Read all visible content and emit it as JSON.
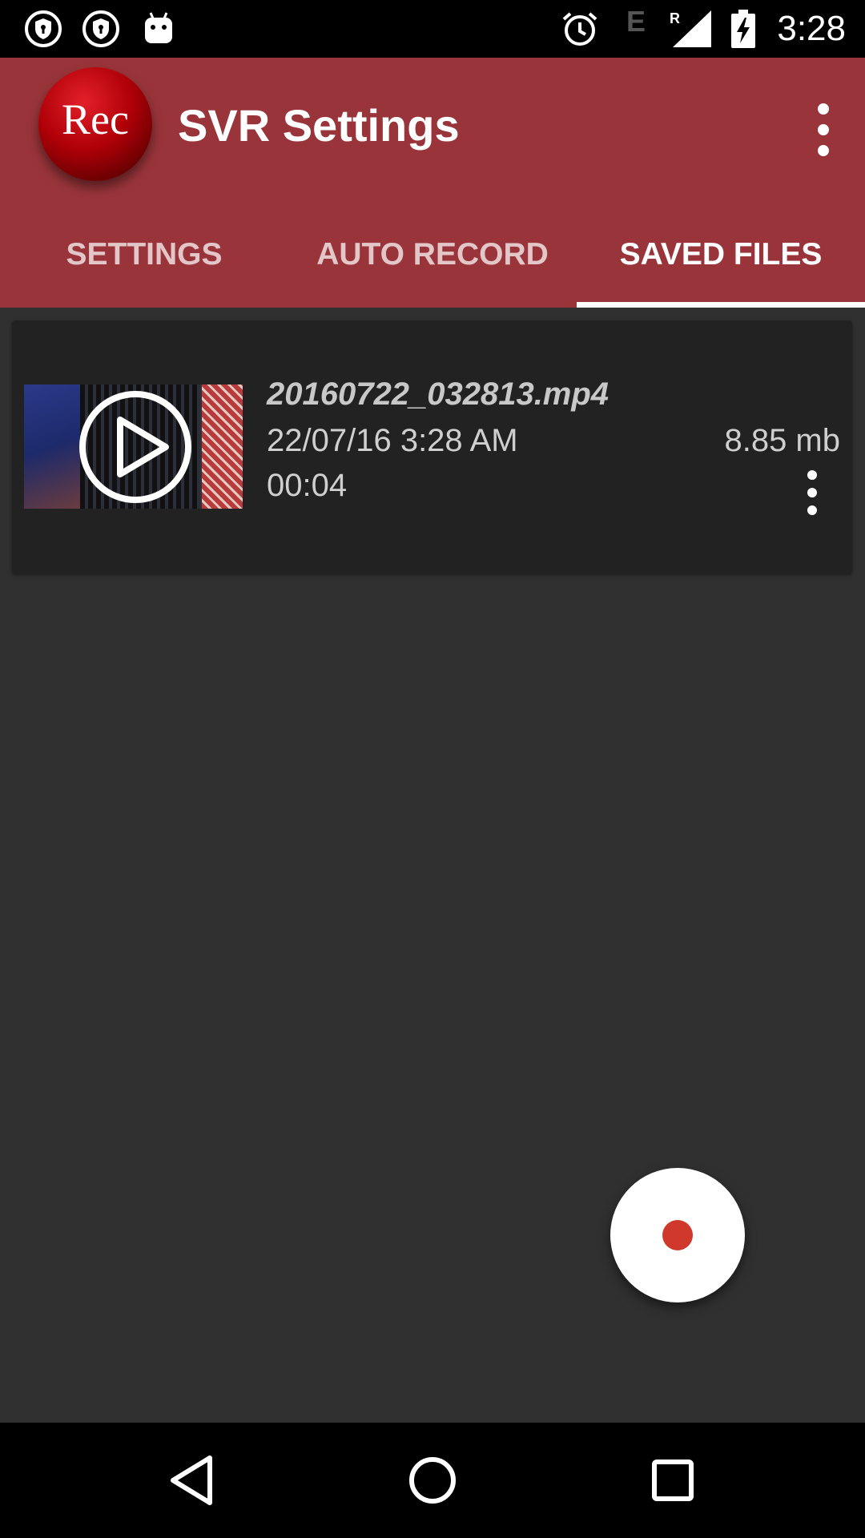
{
  "status_bar": {
    "time": "3:28",
    "network_letter": "E",
    "roaming_letter": "R",
    "icons": [
      "shield-notification-icon",
      "shield-notification-icon",
      "android-icon",
      "alarm-icon",
      "signal-icon",
      "battery-charging-icon"
    ]
  },
  "app_bar": {
    "logo_text": "Rec",
    "title": "SVR Settings",
    "overflow_icon": "more-vert-icon"
  },
  "tabs": [
    {
      "label": "SETTINGS",
      "active": false
    },
    {
      "label": "AUTO RECORD",
      "active": false
    },
    {
      "label": "SAVED FILES",
      "active": true
    }
  ],
  "files": [
    {
      "name": "20160722_032813.mp4",
      "date": "22/07/16 3:28 AM",
      "duration": "00:04",
      "size": "8.85 mb"
    }
  ],
  "fab": {
    "icon": "record-icon",
    "color": "#d0382c"
  },
  "nav": [
    "back-icon",
    "home-icon",
    "recents-icon"
  ],
  "colors": {
    "accent": "#99353a",
    "background": "#303030",
    "card": "#222222"
  }
}
